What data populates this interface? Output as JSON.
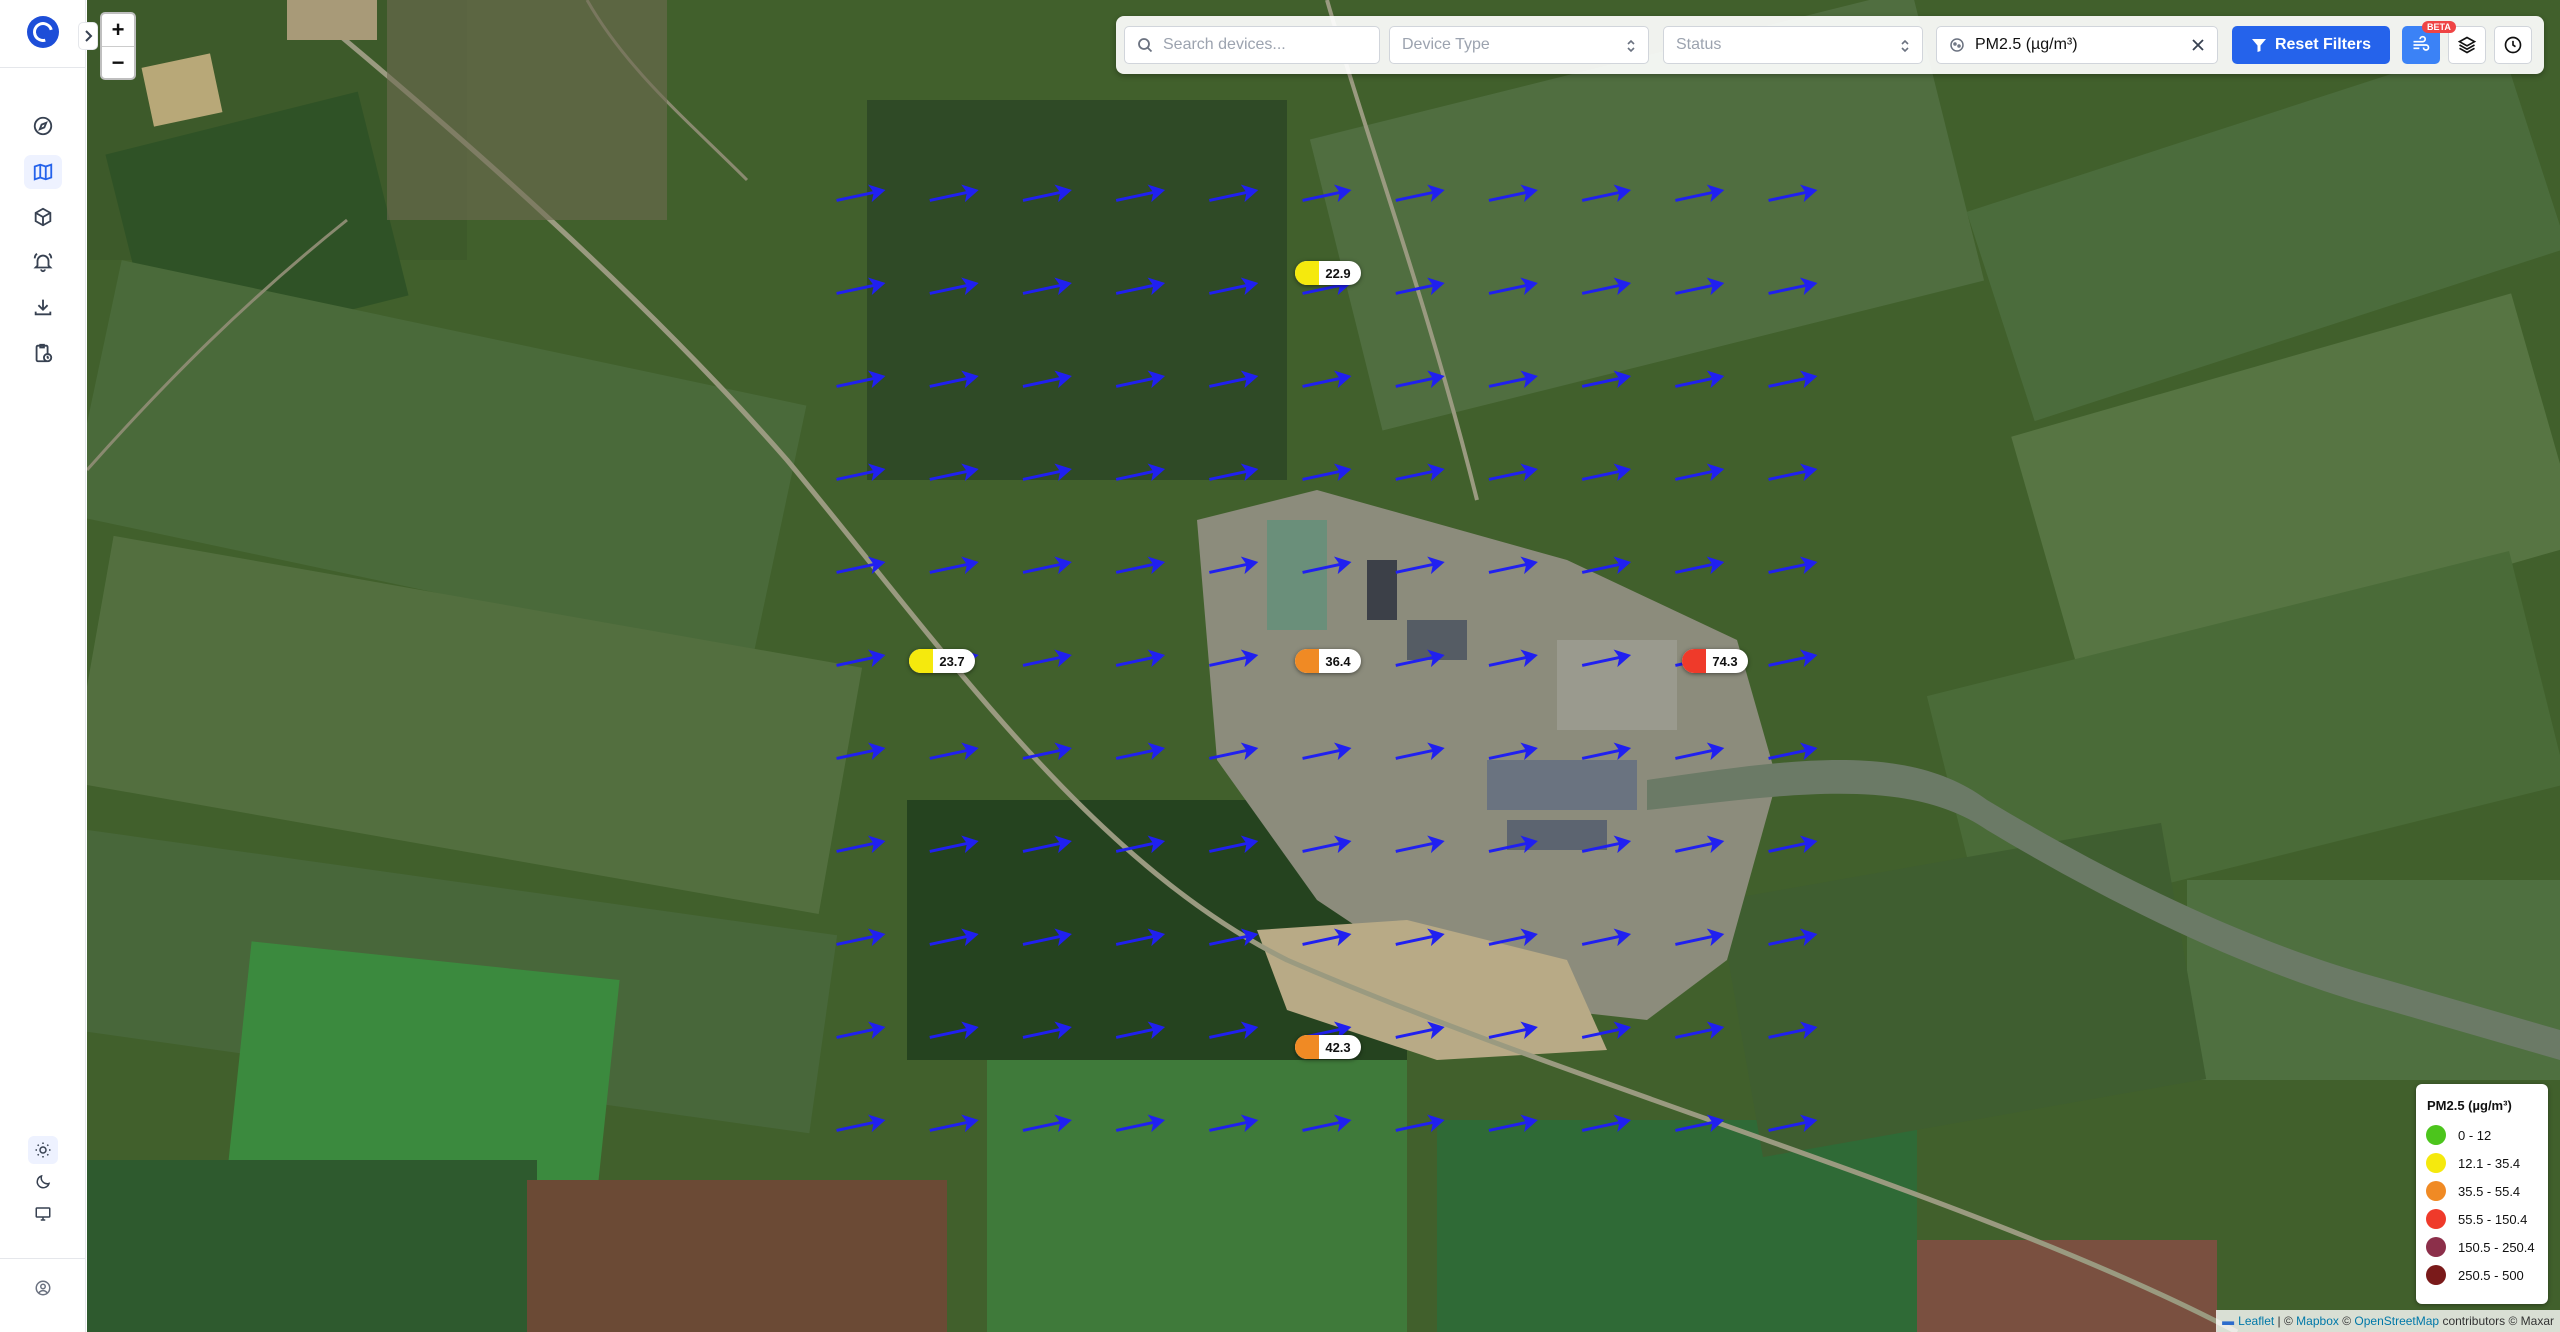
{
  "map": {
    "zoom_in_label": "+",
    "zoom_out_label": "−"
  },
  "toolbar": {
    "search_placeholder": "Search devices...",
    "device_type_placeholder": "Device Type",
    "status_placeholder": "Status",
    "pollutant_filter": "PM2.5 (µg/m³)",
    "reset_label": "Reset Filters",
    "beta_badge": "BETA"
  },
  "sidebar": {
    "items": [
      {
        "icon": "compass-icon",
        "name": "dashboard"
      },
      {
        "icon": "map-icon",
        "name": "map",
        "active": true
      },
      {
        "icon": "cube-icon",
        "name": "devices"
      },
      {
        "icon": "bell-icon",
        "name": "alerts"
      },
      {
        "icon": "download-icon",
        "name": "downloads"
      },
      {
        "icon": "clipboard-clock-icon",
        "name": "reports"
      }
    ],
    "theme": [
      {
        "icon": "sun-icon",
        "active": true
      },
      {
        "icon": "moon-icon"
      },
      {
        "icon": "monitor-icon"
      }
    ],
    "bottom_icon": "user-circle-icon"
  },
  "markers": [
    {
      "value": "22.9",
      "color": "#f5e90d"
    },
    {
      "value": "23.7",
      "color": "#f5e90d"
    },
    {
      "value": "36.4",
      "color": "#f08a24"
    },
    {
      "value": "74.3",
      "color": "#ef3a2a"
    },
    {
      "value": "42.3",
      "color": "#f08a24"
    }
  ],
  "legend": {
    "title": "PM2.5 (µg/m³)",
    "items": [
      {
        "label": "0 - 12",
        "color": "#4cc51c"
      },
      {
        "label": "12.1 - 35.4",
        "color": "#f5e90d"
      },
      {
        "label": "35.5 - 55.4",
        "color": "#f08a24"
      },
      {
        "label": "55.5 - 150.4",
        "color": "#ef3a2a"
      },
      {
        "label": "150.5 - 250.4",
        "color": "#8c2f4a"
      },
      {
        "label": "250.5 - 500",
        "color": "#7a1a1a"
      }
    ]
  },
  "attribution": {
    "leaflet": "Leaflet",
    "sep1": " | © ",
    "mapbox": "Mapbox",
    "sep2": " © ",
    "osm": "OpenStreetMap",
    "rest": " contributors © Maxar"
  },
  "colors": {
    "accent": "#2563eb",
    "wind_arrow": "#2020f0"
  }
}
